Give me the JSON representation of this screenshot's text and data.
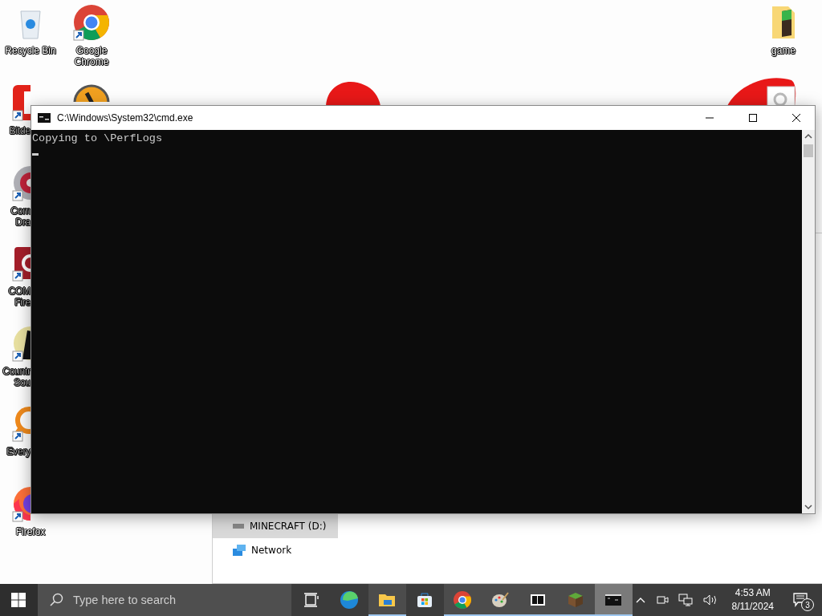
{
  "desktop_icons": [
    {
      "kind": "recycle",
      "label": "Recycle Bin",
      "cut": false,
      "covered": false
    },
    {
      "kind": "bitdefender",
      "label": "Bitde",
      "cut": true,
      "covered": true
    },
    {
      "kind": "disc",
      "label": "Com Dra",
      "cut": true,
      "covered": true
    },
    {
      "kind": "redapp",
      "label": "COM Fire",
      "cut": true,
      "covered": true
    },
    {
      "kind": "game",
      "label": "Countr Sou",
      "cut": true,
      "covered": true
    },
    {
      "kind": "search",
      "label": "Every",
      "cut": true,
      "covered": true
    },
    {
      "kind": "firefox",
      "label": "Firefox",
      "cut": false,
      "covered": true
    },
    {
      "kind": "chrome",
      "label": "Google Chrome",
      "cut": false,
      "covered": false
    },
    {
      "kind": "halflife",
      "covered": true
    }
  ],
  "right_icons": [
    {
      "kind": "folder",
      "label": "game",
      "cut": false,
      "covered": false
    }
  ],
  "explorer": {
    "nav_items": [
      {
        "label": "MINECRAFT (D:)",
        "kind": "drive",
        "selected": true
      },
      {
        "label": "Network",
        "kind": "network",
        "selected": false
      }
    ]
  },
  "console": {
    "title": "C:\\Windows\\System32\\cmd.exe",
    "lines": [
      "Copying to \\PerfLogs"
    ],
    "cursor": true
  },
  "taskbar": {
    "search": {
      "placeholder": "Type here to search"
    },
    "apps": [
      {
        "kind": "taskview",
        "open": false,
        "selected": false
      },
      {
        "kind": "edge",
        "open": false,
        "selected": false
      },
      {
        "kind": "explorer",
        "open": true,
        "selected": false
      },
      {
        "kind": "store",
        "open": false,
        "selected": false
      },
      {
        "kind": "chrome",
        "open": true,
        "selected": false
      },
      {
        "kind": "paint",
        "open": true,
        "selected": false
      },
      {
        "kind": "sevenzip",
        "open": true,
        "selected": false
      },
      {
        "kind": "minecraft",
        "open": true,
        "selected": false
      },
      {
        "kind": "cmd",
        "open": true,
        "selected": true
      }
    ],
    "time": "4:53 AM",
    "date": "8/11/2024",
    "notifications": "3"
  }
}
